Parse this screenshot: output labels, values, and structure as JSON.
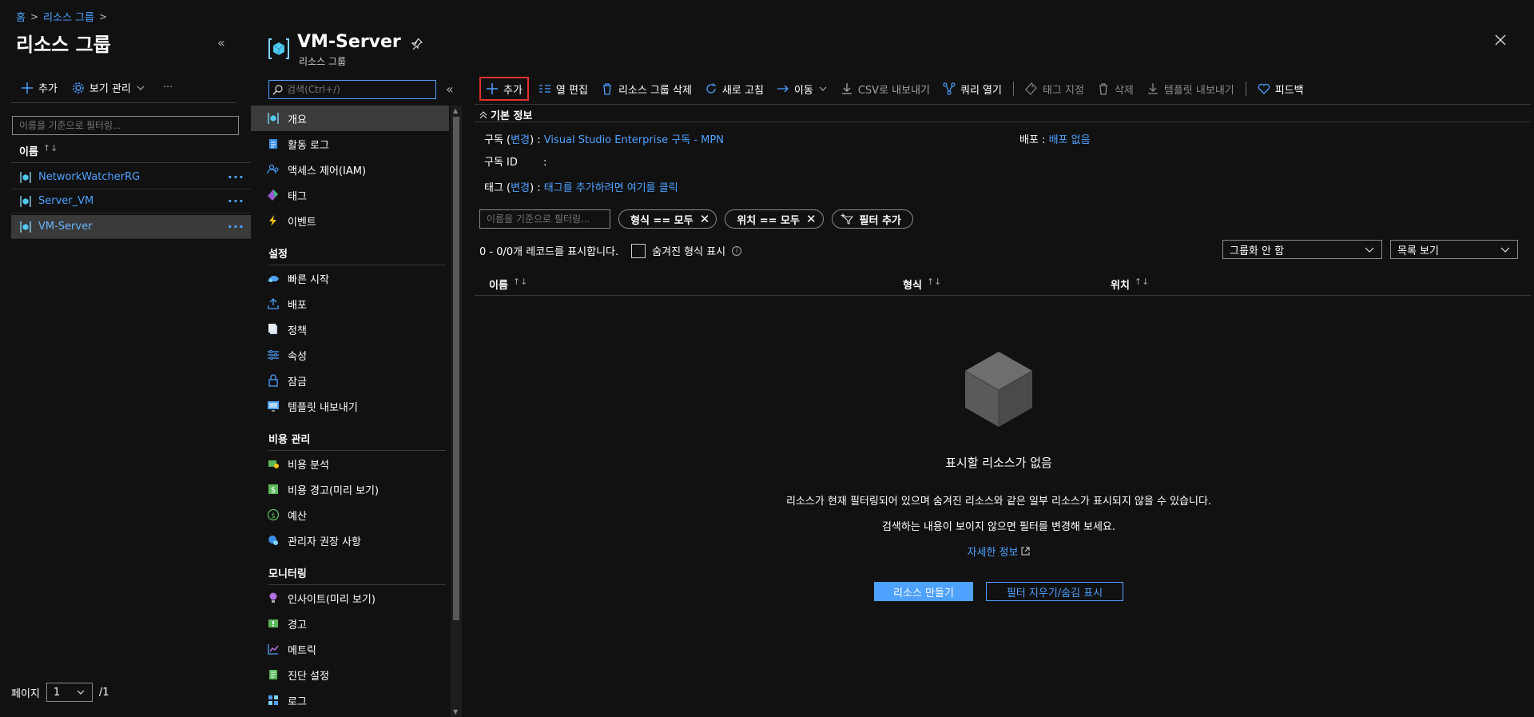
{
  "breadcrumb": {
    "home": "홈",
    "sep": ">",
    "resource_groups": "리소스 그룹"
  },
  "left": {
    "title": "리소스 그룹",
    "collapse": "«",
    "toolbar": {
      "add": "추가",
      "view_manage": "보기 관리",
      "more": "···"
    },
    "filter_placeholder": "이름을 기준으로 필터링...",
    "column_name": "이름",
    "sort_glyph": "↑↓",
    "rows": [
      {
        "name": "NetworkWatcherRG",
        "more": "···"
      },
      {
        "name": "Server_VM",
        "more": "···"
      },
      {
        "name": "VM-Server",
        "more": "···"
      }
    ],
    "pager": {
      "label": "페이지",
      "value": "1",
      "total": "/1"
    }
  },
  "resource": {
    "title": "VM-Server",
    "subtitle": "리소스 그룹"
  },
  "nav": {
    "search_placeholder": "검색(Ctrl+/)",
    "collapse": "«",
    "top": [
      {
        "label": "개요",
        "icon": "overview-icon"
      },
      {
        "label": "활동 로그",
        "icon": "activity-log-icon"
      },
      {
        "label": "액세스 제어(IAM)",
        "icon": "iam-icon"
      },
      {
        "label": "태그",
        "icon": "tag-icon"
      },
      {
        "label": "이벤트",
        "icon": "events-icon"
      }
    ],
    "sections": [
      {
        "title": "설정",
        "items": [
          {
            "label": "빠른 시작",
            "icon": "quickstart-icon"
          },
          {
            "label": "배포",
            "icon": "deployments-icon"
          },
          {
            "label": "정책",
            "icon": "policies-icon"
          },
          {
            "label": "속성",
            "icon": "properties-icon"
          },
          {
            "label": "잠금",
            "icon": "lock-icon"
          },
          {
            "label": "템플릿 내보내기",
            "icon": "export-template-icon"
          }
        ]
      },
      {
        "title": "비용 관리",
        "items": [
          {
            "label": "비용 분석",
            "icon": "cost-analysis-icon"
          },
          {
            "label": "비용 경고(미리 보기)",
            "icon": "cost-alerts-icon"
          },
          {
            "label": "예산",
            "icon": "budgets-icon"
          },
          {
            "label": "관리자 권장 사항",
            "icon": "advisor-icon"
          }
        ]
      },
      {
        "title": "모니터링",
        "items": [
          {
            "label": "인사이트(미리 보기)",
            "icon": "insights-icon"
          },
          {
            "label": "경고",
            "icon": "alerts-icon"
          },
          {
            "label": "메트릭",
            "icon": "metrics-icon"
          },
          {
            "label": "진단 설정",
            "icon": "diagnostic-settings-icon"
          },
          {
            "label": "로그",
            "icon": "logs-icon"
          }
        ]
      }
    ]
  },
  "toolbar": {
    "add": "추가",
    "edit_columns": "열 편집",
    "delete_group": "리소스 그룹 삭제",
    "refresh": "새로 고침",
    "move": "이동",
    "export_csv": "CSV로 내보내기",
    "open_query": "쿼리 열기",
    "assign_tags": "태그 지정",
    "delete": "삭제",
    "export_template": "템플릿 내보내기",
    "feedback": "피드백"
  },
  "essentials": {
    "header": "기본 정보",
    "subscription_label": "구독",
    "change": "변경",
    "subscription_value": "Visual Studio Enterprise 구독 - MPN",
    "subscription_id_label": "구독 ID",
    "subscription_id_value": ":",
    "deployments_label": "배포",
    "deployments_value": "배포 없음",
    "tags_label": "태그",
    "tags_value": "태그를 추가하려면 여기를 클릭"
  },
  "filters": {
    "placeholder": "이름을 기준으로 필터링...",
    "type_pill": "형식 == 모두",
    "location_pill": "위치 == 모두",
    "add_filter": "필터 추가"
  },
  "records": {
    "count_text": "0 - 0/0개 레코드를 표시합니다.",
    "show_hidden": "숨겨진 형식 표시",
    "grouping": "그룹화 안 함",
    "view": "목록 보기"
  },
  "columns": {
    "name": "이름",
    "type": "형식",
    "location": "위치"
  },
  "empty": {
    "title": "표시할 리소스가 없음",
    "desc1": "리소스가 현재 필터링되어 있으며 숨겨진 리소스와 같은 일부 리소스가 표시되지 않을 수 있습니다.",
    "desc2": "검색하는 내용이 보이지 않으면 필터를 변경해 보세요.",
    "learn_more": "자세한 정보",
    "create_button": "리소스 만들기",
    "clear_button": "필터 지우기/숨김 표시"
  },
  "colors": {
    "accent": "#4ea1ff",
    "highlight": "#e0332f",
    "background": "#111111"
  }
}
